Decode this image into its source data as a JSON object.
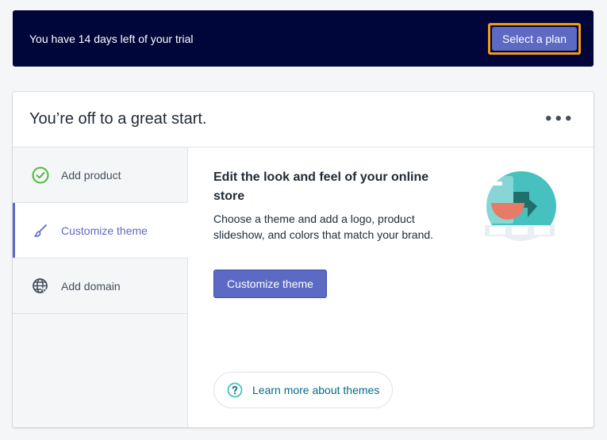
{
  "banner": {
    "trial_text": "You have 14 days left of your trial",
    "plan_button_label": "Select a plan"
  },
  "card": {
    "title": "You’re off to a great start.",
    "more_label": "•••",
    "steps": [
      {
        "label": "Add product",
        "icon": "check-circle-icon",
        "status": "complete"
      },
      {
        "label": "Customize theme",
        "icon": "paintbrush-icon",
        "status": "active"
      },
      {
        "label": "Add domain",
        "icon": "globe-icon",
        "status": "pending"
      }
    ],
    "panel": {
      "title": "Edit the look and feel of your online store",
      "description": "Choose a theme and add a logo, product slideshow, and colors that match your brand.",
      "button_label": "Customize theme",
      "learn_more_label": "Learn more about themes"
    }
  },
  "colors": {
    "banner_bg": "#000639",
    "accent": "#5c6ac4",
    "focus_ring": "#f49a13",
    "success": "#50b83c",
    "link": "#006e8a",
    "teal": "#47c1bf"
  }
}
